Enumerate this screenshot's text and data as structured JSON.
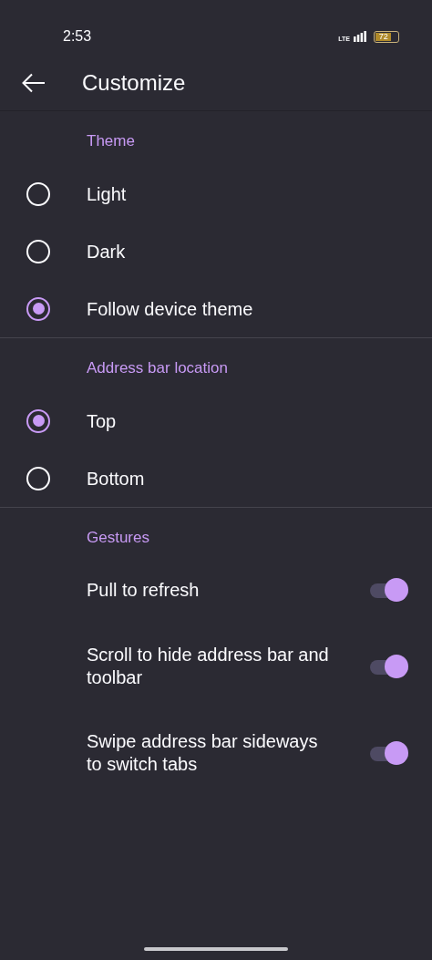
{
  "status_bar": {
    "time": "2:53",
    "network": "LTE",
    "battery": "72"
  },
  "app_bar": {
    "title": "Customize"
  },
  "sections": [
    {
      "title": "Theme",
      "items": [
        {
          "kind": "radio",
          "label": "Light",
          "selected": false
        },
        {
          "kind": "radio",
          "label": "Dark",
          "selected": false
        },
        {
          "kind": "radio",
          "label": "Follow device theme",
          "selected": true
        }
      ]
    },
    {
      "title": "Address bar location",
      "items": [
        {
          "kind": "radio",
          "label": "Top",
          "selected": true
        },
        {
          "kind": "radio",
          "label": "Bottom",
          "selected": false
        }
      ]
    },
    {
      "title": "Gestures",
      "items": [
        {
          "kind": "switch",
          "label": "Pull to refresh",
          "on": true
        },
        {
          "kind": "switch",
          "label": "Scroll to hide address bar and toolbar",
          "on": true
        },
        {
          "kind": "switch",
          "label": "Swipe address bar sideways to switch tabs",
          "on": true
        }
      ]
    }
  ]
}
